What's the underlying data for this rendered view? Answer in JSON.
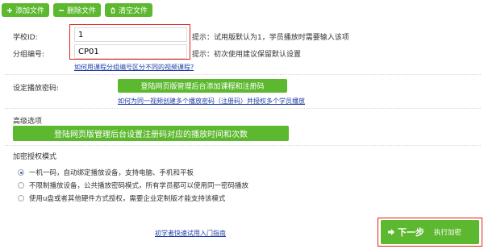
{
  "toolbar": {
    "add_file": "添加文件",
    "delete_file": "删除文件",
    "clear_file": "清空文件"
  },
  "form": {
    "school_id_label": "学校ID:",
    "school_id_value": "1",
    "school_id_hint": "提示：试用版默认为1，学员播放时需要输入该项",
    "group_no_label": "分组编号:",
    "group_no_value": "CP01",
    "group_no_hint": "提示：初次使用建议保留默认设置",
    "group_link": "如何用课程分组编号区分不同的视频课程?"
  },
  "password": {
    "label": "设定播放密码:",
    "button": "登陆网页版管理后台添加课程和注册码",
    "link": "如何为同一视频创建多个播放密码（注册码）并授权多个学员播放"
  },
  "advanced": {
    "label": "高级选项",
    "button": "登陆网页版管理后台设置注册码对应的播放时间和次数"
  },
  "auth": {
    "label": "加密授权模式",
    "options": [
      {
        "text": "一机一码，自动绑定播放设备，支持电脑、手机和平板",
        "selected": true
      },
      {
        "text": "不限制播放设备，公共播放密码模式，所有学员都可以使用同一密码播放",
        "selected": false
      },
      {
        "text": "使用u盘或者其他硬件方式授权，需要企业定制版才能支持该模式",
        "selected": false
      }
    ]
  },
  "footer": {
    "guide_link": "初学者快速试用入门指南",
    "next_label": "下一步",
    "next_sub": "执行加密"
  },
  "colors": {
    "accent_green": "#5cb82e",
    "highlight_red": "#e02020",
    "link_blue": "#1f3fa8"
  }
}
